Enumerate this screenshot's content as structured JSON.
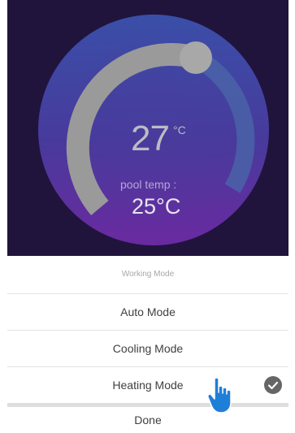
{
  "thermostat": {
    "set_temperature": "27",
    "set_unit": "°C",
    "pool_temp_label": "pool temp :",
    "pool_temperature": "25°C"
  },
  "working_mode_sheet": {
    "title": "Working Mode",
    "options": [
      {
        "label": "Auto Mode",
        "selected": false
      },
      {
        "label": "Cooling Mode",
        "selected": false
      },
      {
        "label": "Heating Mode",
        "selected": true
      }
    ],
    "done_label": "Done"
  },
  "icons": {
    "selected_indicator": "check-circle-icon",
    "pointer": "hand-pointer-icon"
  },
  "colors": {
    "hero_background": "#20143d",
    "dial_gradient_top": "#3a4fa8",
    "dial_gradient_bottom": "#6a2aa0",
    "dial_track": "#9a9a9a",
    "pointer_hand": "#1e7fd8",
    "check_background": "#666666"
  }
}
